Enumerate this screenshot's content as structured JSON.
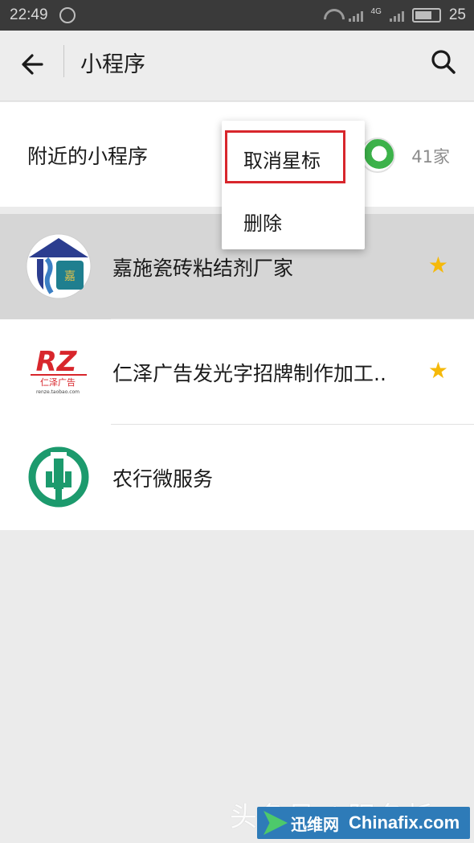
{
  "status_bar": {
    "time": "22:49",
    "signal_badge": "4G",
    "battery": "25"
  },
  "header": {
    "title": "小程序"
  },
  "nearby": {
    "label": "附近的小程序",
    "count": "41家"
  },
  "popup_menu": {
    "items": [
      {
        "label": "取消星标",
        "highlighted": true
      },
      {
        "label": "删除",
        "highlighted": false
      }
    ],
    "highlight_color": "#d8262c"
  },
  "mini_programs": [
    {
      "name": "嘉施瓷砖粘结剂厂家",
      "starred": true,
      "selected": true,
      "icon": "jiashi-logo-icon"
    },
    {
      "name": "仁泽广告发光字招牌制作加工..",
      "starred": true,
      "selected": false,
      "icon": "renze-logo-icon"
    },
    {
      "name": "农行微服务",
      "starred": false,
      "selected": false,
      "icon": "abc-bank-logo-icon"
    }
  ],
  "star_glyph": "★",
  "star_color": "#f5b90a",
  "watermark": {
    "text": "头条号 / 阳冬析",
    "brand_cn": "迅维网",
    "brand_en": "Chinafix.com"
  },
  "colors": {
    "statusbar_bg": "#3a3a3a",
    "page_bg": "#ebebeb",
    "selected_row_bg": "#d6d6d6",
    "abc_green": "#1c9a6d"
  }
}
